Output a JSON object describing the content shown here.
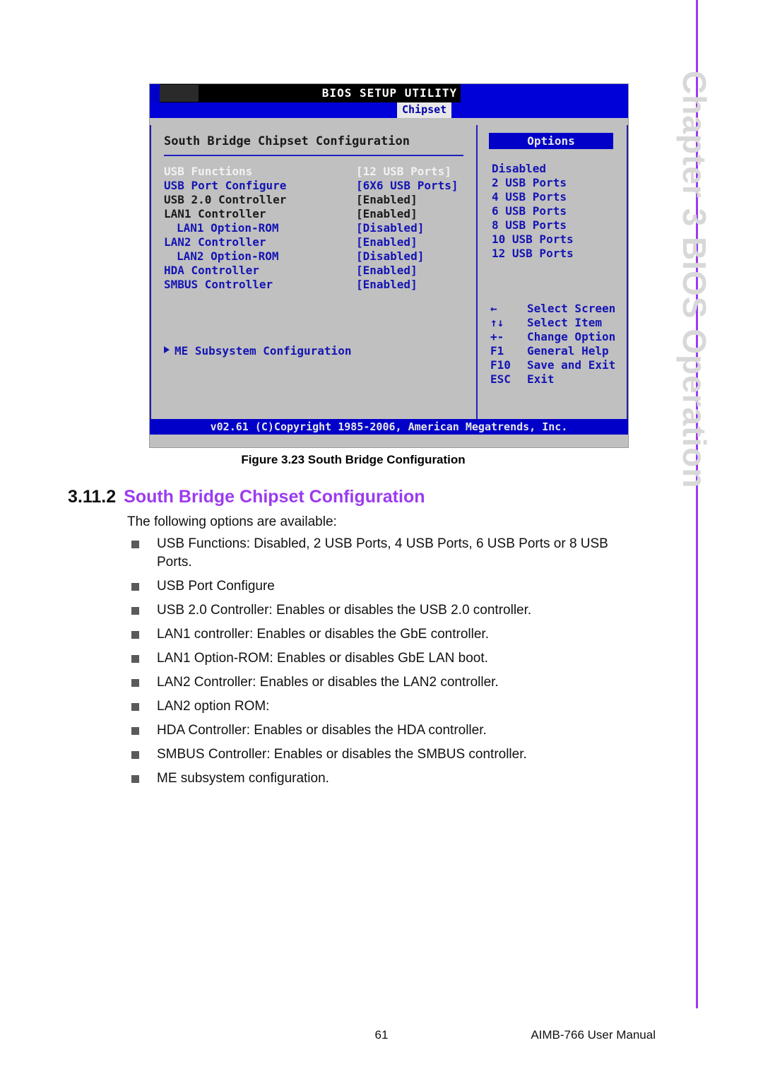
{
  "chapter_rail": {
    "label": "Chapter 3    BIOS Operation",
    "accent_color": "#9B3BEF"
  },
  "bios": {
    "title": "BIOS SETUP UTILITY",
    "active_tab": "Chipset",
    "panel_title": "South Bridge Chipset Configuration",
    "menu_items": [
      {
        "label": "USB Functions",
        "value": "[12 USB Ports]",
        "label_color": "selected",
        "value_color": "selected",
        "indent": false
      },
      {
        "label": "USB Port Configure",
        "value": "[6X6 USB Ports]",
        "label_color": "blue",
        "value_color": "blue",
        "indent": false
      },
      {
        "label": "USB 2.0 Controller",
        "value": "[Enabled]",
        "label_color": "dark",
        "value_color": "dark",
        "indent": false
      },
      {
        "label": "LAN1 Controller",
        "value": "[Enabled]",
        "label_color": "dark",
        "value_color": "dark",
        "indent": false
      },
      {
        "label": "LAN1 Option-ROM",
        "value": "[Disabled]",
        "label_color": "blue",
        "value_color": "blue",
        "indent": true
      },
      {
        "label": "LAN2 Controller",
        "value": "[Enabled]",
        "label_color": "blue",
        "value_color": "blue",
        "indent": false
      },
      {
        "label": "LAN2 Option-ROM",
        "value": "[Disabled]",
        "label_color": "blue",
        "value_color": "blue",
        "indent": true
      },
      {
        "label": "HDA Controller",
        "value": "[Enabled]",
        "label_color": "blue",
        "value_color": "blue",
        "indent": false
      },
      {
        "label": "SMBUS Controller",
        "value": "[Enabled]",
        "label_color": "blue",
        "value_color": "blue",
        "indent": false
      }
    ],
    "submenu_item": "ME Subsystem Configuration",
    "options_header": "Options",
    "options": [
      "Disabled",
      "2 USB Ports",
      "4 USB Ports",
      "6 USB Ports",
      "8 USB Ports",
      "10 USB Ports",
      "12 USB Ports"
    ],
    "key_legend": [
      {
        "key": "←",
        "desc": "Select Screen"
      },
      {
        "key": "↑↓",
        "desc": "Select Item"
      },
      {
        "key": "+-",
        "desc": "Change Option"
      },
      {
        "key": "F1",
        "desc": "General Help"
      },
      {
        "key": "F10",
        "desc": "Save and Exit"
      },
      {
        "key": "ESC",
        "desc": "Exit"
      }
    ],
    "footer": "v02.61 (C)Copyright 1985-2006, American Megatrends, Inc."
  },
  "figure": {
    "caption": "Figure 3.23 South Bridge Configuration"
  },
  "section": {
    "number": "3.11.2",
    "title": "South Bridge Chipset Configuration",
    "title_color": "#9B3BEF",
    "intro": "The following options are available:",
    "bullets": [
      "USB Functions: Disabled, 2 USB Ports, 4 USB Ports, 6 USB Ports or 8 USB Ports.",
      "USB Port Configure",
      "USB 2.0 Controller: Enables or disables the USB 2.0 controller.",
      "LAN1 controller: Enables or disables the GbE controller.",
      "LAN1 Option-ROM: Enables or disables GbE LAN boot.",
      "LAN2 Controller: Enables or disables the LAN2 controller.",
      "LAN2 option ROM:",
      "HDA Controller: Enables or disables the HDA controller.",
      "SMBUS Controller: Enables or disables the SMBUS controller.",
      "ME subsystem configuration."
    ]
  },
  "page_footer": {
    "page_number": "61",
    "manual": "AIMB-766 User Manual"
  }
}
